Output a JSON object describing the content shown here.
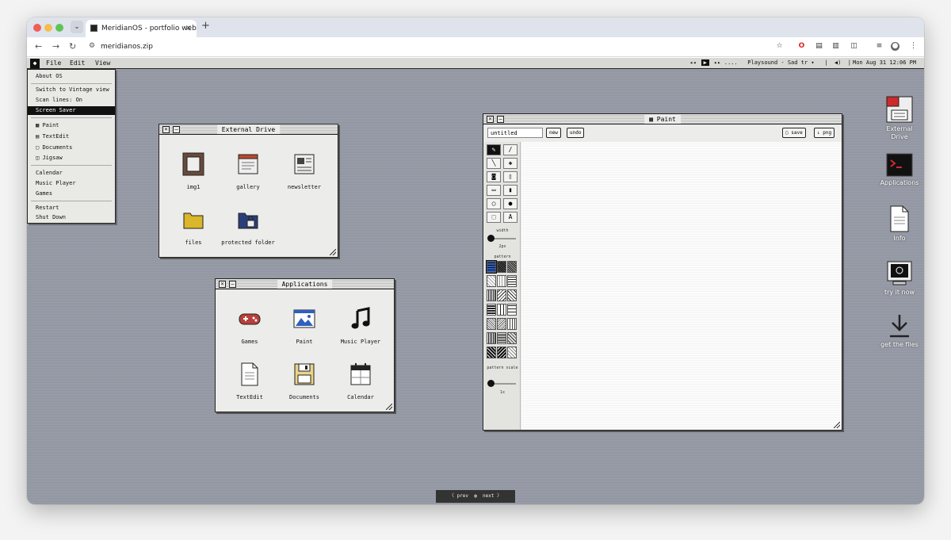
{
  "browser": {
    "tab_title": "MeridianOS - portfolio website",
    "tab_close": "×",
    "new_tab": "+",
    "url": "meridianos.zip",
    "chevron": "⌄"
  },
  "menubar": {
    "menus": [
      "File",
      "Edit",
      "View"
    ],
    "player": {
      "rewind": "◂◂",
      "play": "▶",
      "forward": "▸▸",
      "dots": "....",
      "track": "Playsound - Sad tr ▾",
      "sep": "|",
      "volume": "◀)"
    },
    "clock": "Mon Aug 31 12:06 PM"
  },
  "file_menu": {
    "items": [
      {
        "label": "About OS"
      },
      {
        "label": "Switch to Vintage view"
      },
      {
        "label": "Scan lines: On"
      },
      {
        "label": "Screen Saver",
        "selected": true
      },
      {
        "label": "Paint"
      },
      {
        "label": "TextEdit"
      },
      {
        "label": "Documents"
      },
      {
        "label": "Jigsaw"
      },
      {
        "label": "Calendar"
      },
      {
        "label": "Music Player"
      },
      {
        "label": "Games"
      },
      {
        "label": "Restart"
      },
      {
        "label": "Shut Down"
      }
    ]
  },
  "external_drive": {
    "title": "External Drive",
    "items": [
      {
        "label": "img1",
        "icon": "picture-frame-icon"
      },
      {
        "label": "gallery",
        "icon": "gallery-icon"
      },
      {
        "label": "newsletter",
        "icon": "newsletter-icon"
      },
      {
        "label": "files",
        "icon": "folder-icon"
      },
      {
        "label": "protected folder",
        "icon": "locked-folder-icon"
      }
    ]
  },
  "applications": {
    "title": "Applications",
    "items": [
      {
        "label": "Games",
        "icon": "gamepad-icon"
      },
      {
        "label": "Paint",
        "icon": "paint-icon"
      },
      {
        "label": "Music Player",
        "icon": "music-note-icon"
      },
      {
        "label": "TextEdit",
        "icon": "document-icon"
      },
      {
        "label": "Documents",
        "icon": "floppy-icon"
      },
      {
        "label": "Calendar",
        "icon": "calendar-icon"
      }
    ]
  },
  "paint": {
    "title": "Paint",
    "filename": "untitled",
    "new_label": "new",
    "undo_label": "undo",
    "save_label": "save",
    "png_label": "↓ png",
    "width_label": "width",
    "width_value": "2px",
    "pattern_label": "pattern",
    "pattern_scale_label": "pattern scale",
    "pattern_scale_value": "1x"
  },
  "desktop_icons": [
    {
      "label": "External Drive",
      "icon": "external-drive-icon"
    },
    {
      "label": "Applications",
      "icon": "terminal-icon"
    },
    {
      "label": "Info",
      "icon": "info-document-icon"
    },
    {
      "label": "try it now",
      "icon": "computer-icon"
    },
    {
      "label": "get the files",
      "icon": "download-icon"
    }
  ],
  "pager": {
    "prev": "〈 prev",
    "next": "next 〉"
  },
  "colors": {
    "desktop": "#969aa6",
    "menubar": "#d8d8d4",
    "accent_red": "#cc2b2b",
    "folder_yellow": "#d9b62a",
    "blue": "#2f5fbf"
  }
}
